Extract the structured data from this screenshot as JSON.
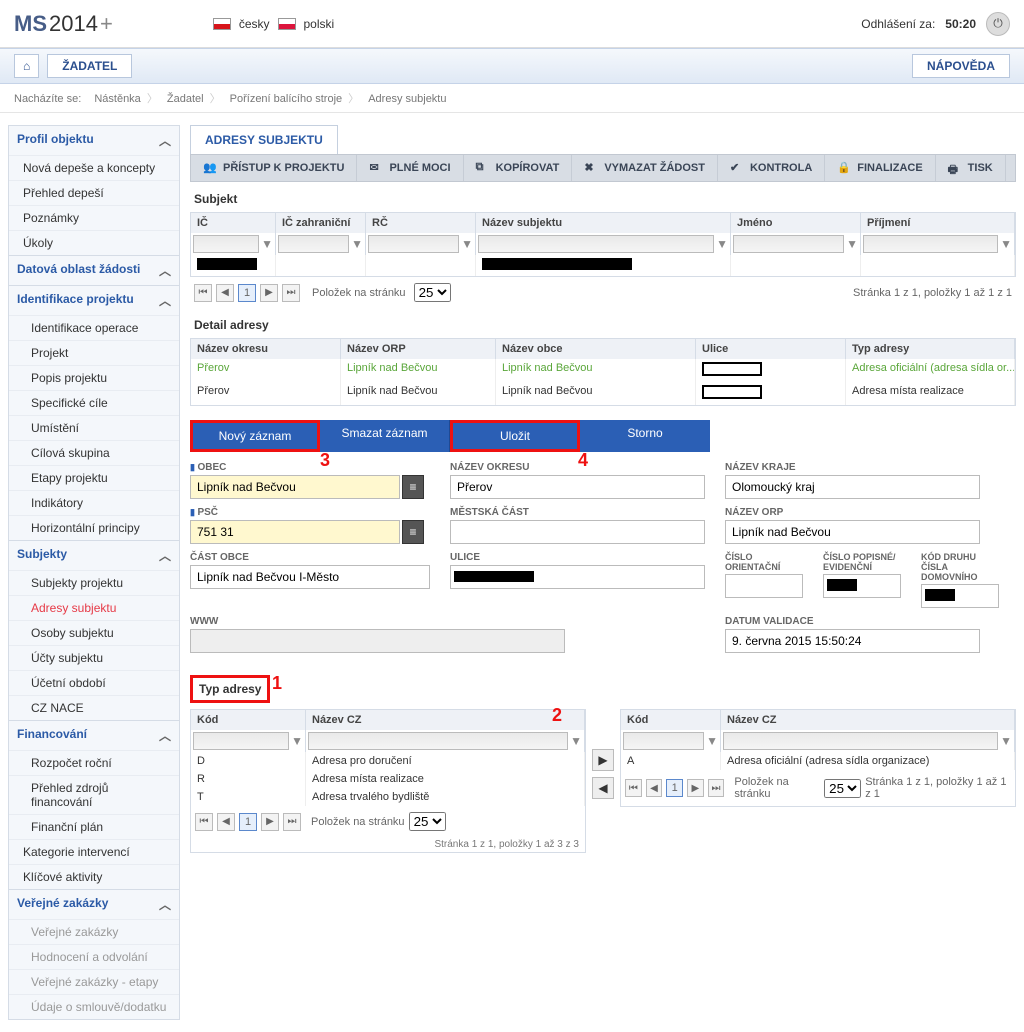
{
  "header": {
    "logo": "MS2014+",
    "langs": [
      {
        "label": "česky"
      },
      {
        "label": "polski"
      }
    ],
    "logout_label": "Odhlášení za:",
    "logout_time": "50:20"
  },
  "nav": {
    "zadatel": "ŽADATEL",
    "napoveda": "NÁPOVĚDA"
  },
  "breadcrumb": {
    "label": "Nacházíte se:",
    "items": [
      "Nástěnka",
      "Žadatel",
      "Pořízení balícího stroje",
      "Adresy subjektu"
    ]
  },
  "sidebar": {
    "profil": "Profil objektu",
    "items1": [
      "Nová depeše a koncepty",
      "Přehled depeší",
      "Poznámky",
      "Úkoly"
    ],
    "datova": "Datová oblast žádosti",
    "ident": "Identifikace projektu",
    "ident_items": [
      "Identifikace operace",
      "Projekt",
      "Popis projektu",
      "Specifické cíle",
      "Umístění",
      "Cílová skupina",
      "Etapy projektu",
      "Indikátory",
      "Horizontální principy"
    ],
    "subjekty": "Subjekty",
    "subjekty_items": [
      "Subjekty projektu",
      "Adresy subjektu",
      "Osoby subjektu",
      "Účty subjektu",
      "Účetní období",
      "CZ NACE"
    ],
    "financ": "Financování",
    "financ_items": [
      "Rozpočet roční",
      "Přehled zdrojů financování",
      "Finanční plán"
    ],
    "kategorie": "Kategorie intervencí",
    "klicove": "Klíčové aktivity",
    "verejne": "Veřejné zakázky",
    "verejne_items": [
      "Veřejné zakázky",
      "Hodnocení a odvolání",
      "Veřejné zakázky - etapy",
      "Údaje o smlouvě/dodatku"
    ]
  },
  "main": {
    "tab": "ADRESY SUBJEKTU",
    "tools": [
      "PŘÍSTUP K PROJEKTU",
      "PLNÉ MOCI",
      "KOPÍROVAT",
      "VYMAZAT ŽÁDOST",
      "KONTROLA",
      "FINALIZACE",
      "TISK"
    ],
    "subjekt_title": "Subjekt",
    "subjekt_cols": [
      "IČ",
      "IČ zahraniční",
      "RČ",
      "Název subjektu",
      "Jméno",
      "Příjmení"
    ],
    "pager_label": "Položek na stránku",
    "pager_size": "25",
    "pager_info": "Stránka 1 z 1, položky 1 až 1 z 1",
    "detail_title": "Detail adresy",
    "detail_cols": [
      "Název okresu",
      "Název ORP",
      "Název obce",
      "Ulice",
      "Typ adresy"
    ],
    "detail_rows": [
      {
        "okres": "Přerov",
        "orp": "Lipník nad Bečvou",
        "obec": "Lipník nad Bečvou",
        "ulice": "",
        "typ": "Adresa oficiální (adresa sídla or...",
        "cls": "green"
      },
      {
        "okres": "Přerov",
        "orp": "Lipník nad Bečvou",
        "obec": "Lipník nad Bečvou",
        "ulice": "",
        "typ": "Adresa místa realizace",
        "cls": ""
      }
    ],
    "actions": {
      "novy": "Nový záznam",
      "smazat": "Smazat záznam",
      "ulozit": "Uložit",
      "storno": "Storno"
    },
    "form": {
      "obec_l": "OBEC",
      "obec": "Lipník nad Bečvou",
      "okres_l": "NÁZEV OKRESU",
      "okres": "Přerov",
      "kraj_l": "NÁZEV KRAJE",
      "kraj": "Olomoucký kraj",
      "psc_l": "PSČ",
      "psc": "751 31",
      "cast_l": "MĚSTSKÁ ČÁST",
      "cast": "",
      "orp_l": "NÁZEV ORP",
      "orp": "Lipník nad Bečvou",
      "castobce_l": "ČÁST OBCE",
      "castobce": "Lipník nad Bečvou I-Město",
      "ulice_l": "ULICE",
      "ulice": "",
      "orient_l": "ČÍSLO ORIENTAČNÍ",
      "popis_l": "ČÍSLO POPISNÉ/\nEVIDENČNÍ",
      "druh_l": "KÓD DRUHU ČÍSLA\nDOMOVNÍHO",
      "www_l": "WWW",
      "www": "",
      "datum_l": "DATUM VALIDACE",
      "datum": "9. června 2015 15:50:24"
    },
    "type_title": "Typ adresy",
    "type_cols": [
      "Kód",
      "Název CZ"
    ],
    "type_left": [
      {
        "k": "D",
        "n": "Adresa pro doručení"
      },
      {
        "k": "R",
        "n": "Adresa místa realizace"
      },
      {
        "k": "T",
        "n": "Adresa trvalého bydliště"
      }
    ],
    "type_right": [
      {
        "k": "A",
        "n": "Adresa oficiální (adresa sídla organizace)"
      }
    ],
    "type_pager_l": "Stránka 1 z 1, položky 1 až 3 z 3",
    "type_pager_r": "Stránka 1 z 1, položky 1 až 1 z 1"
  }
}
